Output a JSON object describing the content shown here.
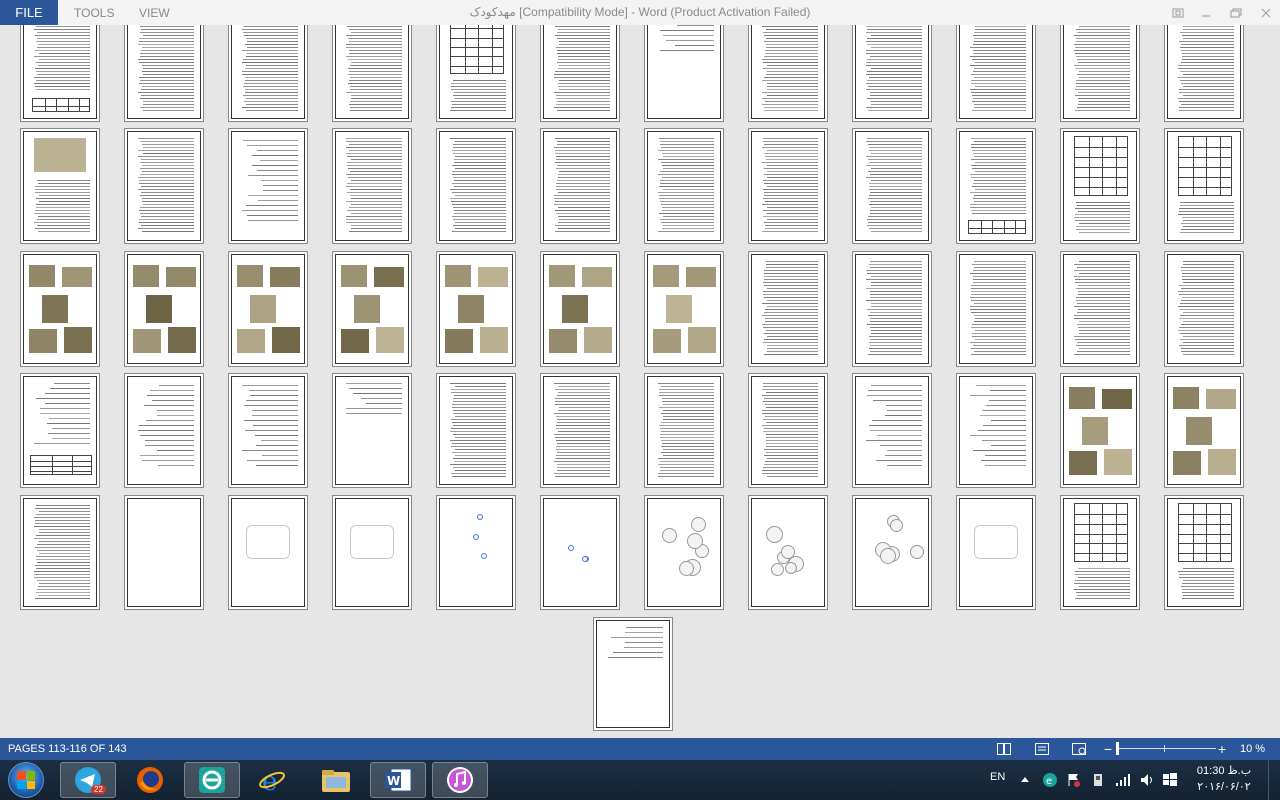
{
  "titlebar": {
    "tabs": [
      "FILE",
      "TOOLS",
      "VIEW"
    ],
    "title": "مهدکودک [Compatibility Mode] - Word (Product Activation Failed)",
    "controls": [
      "restore-layout-icon",
      "minimize-icon",
      "maximize-icon",
      "close-icon"
    ]
  },
  "document": {
    "view_mode": "multi-page thumbnails",
    "page_kinds": [
      "text",
      "text-table",
      "table",
      "photo-collage",
      "sketch",
      "diagram",
      "blank"
    ]
  },
  "statusbar": {
    "pages_text": "PAGES 113-116 OF 143",
    "views": [
      "read-mode-icon",
      "print-layout-icon",
      "web-layout-icon"
    ],
    "zoom_out": "−",
    "zoom_in": "+",
    "zoom_level": "10 %",
    "zoom_fraction": 0.1
  },
  "taskbar": {
    "apps": [
      {
        "name": "telegram",
        "badge": "22",
        "color": "#2ca5e0"
      },
      {
        "name": "firefox",
        "color": "#e66000"
      },
      {
        "name": "eset",
        "color": "#1ba39c"
      },
      {
        "name": "internet-explorer",
        "color": "#1e88e5"
      },
      {
        "name": "file-explorer",
        "color": "#e8c36a"
      },
      {
        "name": "word",
        "color": "#2b579a",
        "active": true
      },
      {
        "name": "itunes",
        "color": "#c857d8"
      }
    ],
    "language": "EN",
    "clock_time": "ب.ظ 01:30",
    "clock_date": "۲۰۱۶/۰۶/۰۲"
  }
}
